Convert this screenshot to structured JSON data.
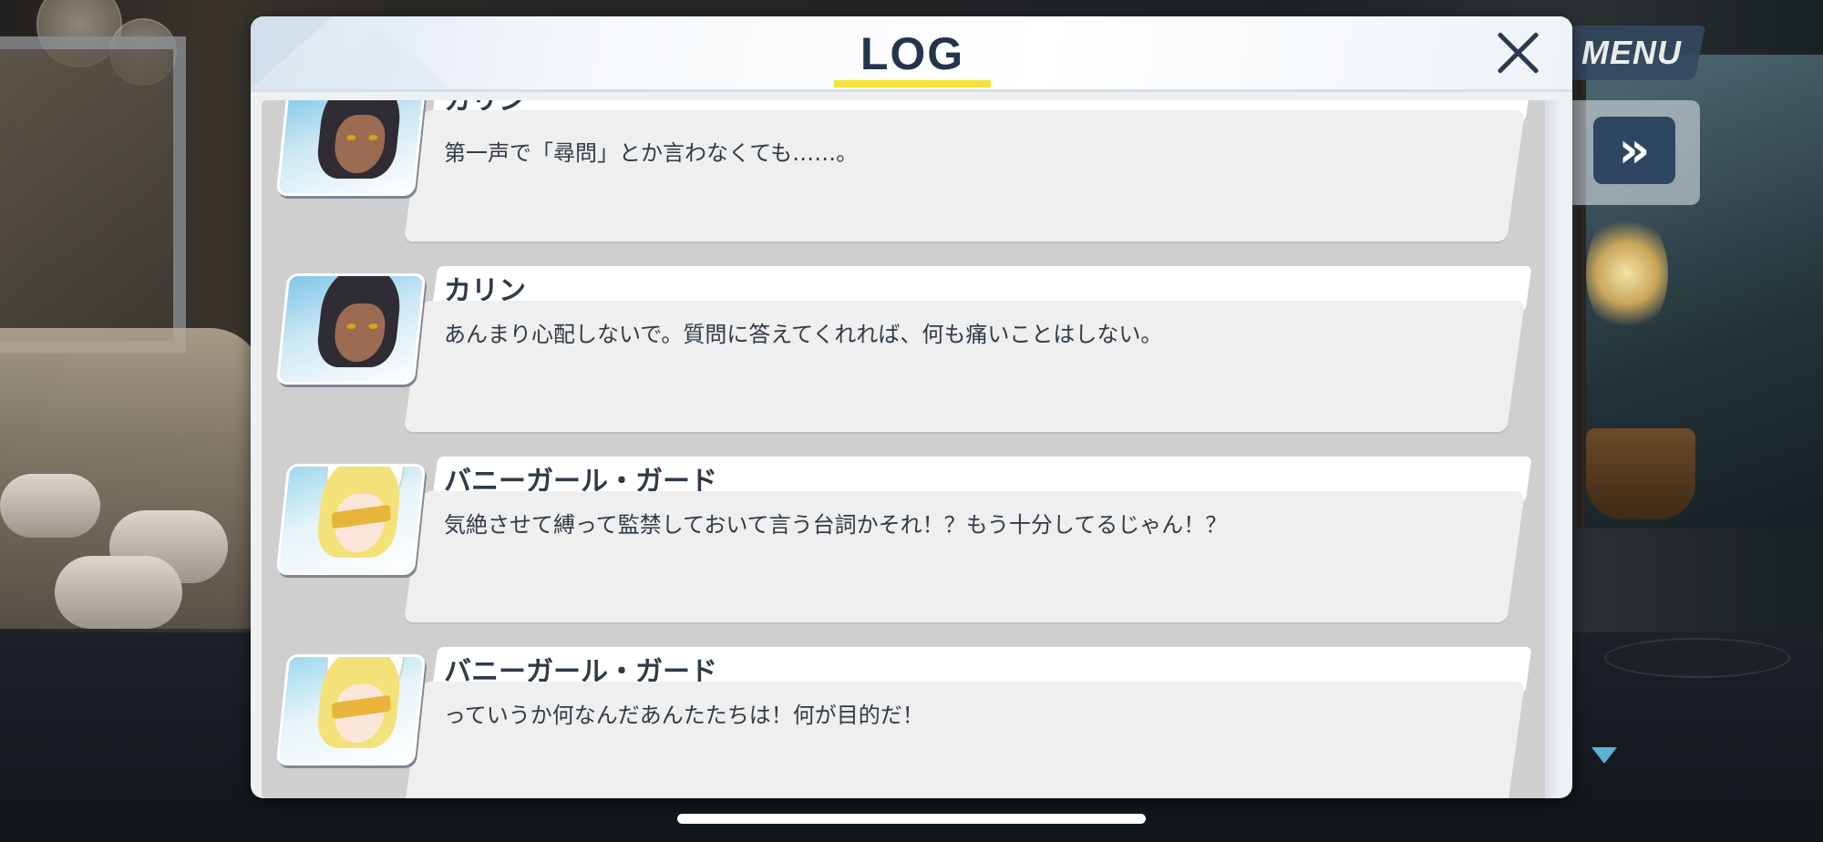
{
  "hud": {
    "menu_label": "MENU",
    "skip_label": "»"
  },
  "log": {
    "title": "LOG",
    "close_icon": "close-icon",
    "entries": [
      {
        "speaker": "カリン",
        "portrait": "karin-portrait",
        "text": "第一声で「尋問」とか言わなくても……。"
      },
      {
        "speaker": "カリン",
        "portrait": "karin-portrait",
        "text": "あんまり心配しないで。質問に答えてくれれば、何も痛いことはしない。"
      },
      {
        "speaker": "バニーガール・ガード",
        "portrait": "bunny-guard-portrait",
        "text": "気絶させて縛って監禁しておいて言う台詞かそれ！？もう十分してるじゃん！？"
      },
      {
        "speaker": "バニーガール・ガード",
        "portrait": "bunny-guard-portrait",
        "text": "っていうか何なんだあんたたちは！何が目的だ！"
      }
    ]
  },
  "colors": {
    "title_text": "#24344a",
    "title_underline": "#f3e23a",
    "hud_button": "#2f4660",
    "bubble": "#efefef",
    "name_bar": "#ffffff"
  }
}
